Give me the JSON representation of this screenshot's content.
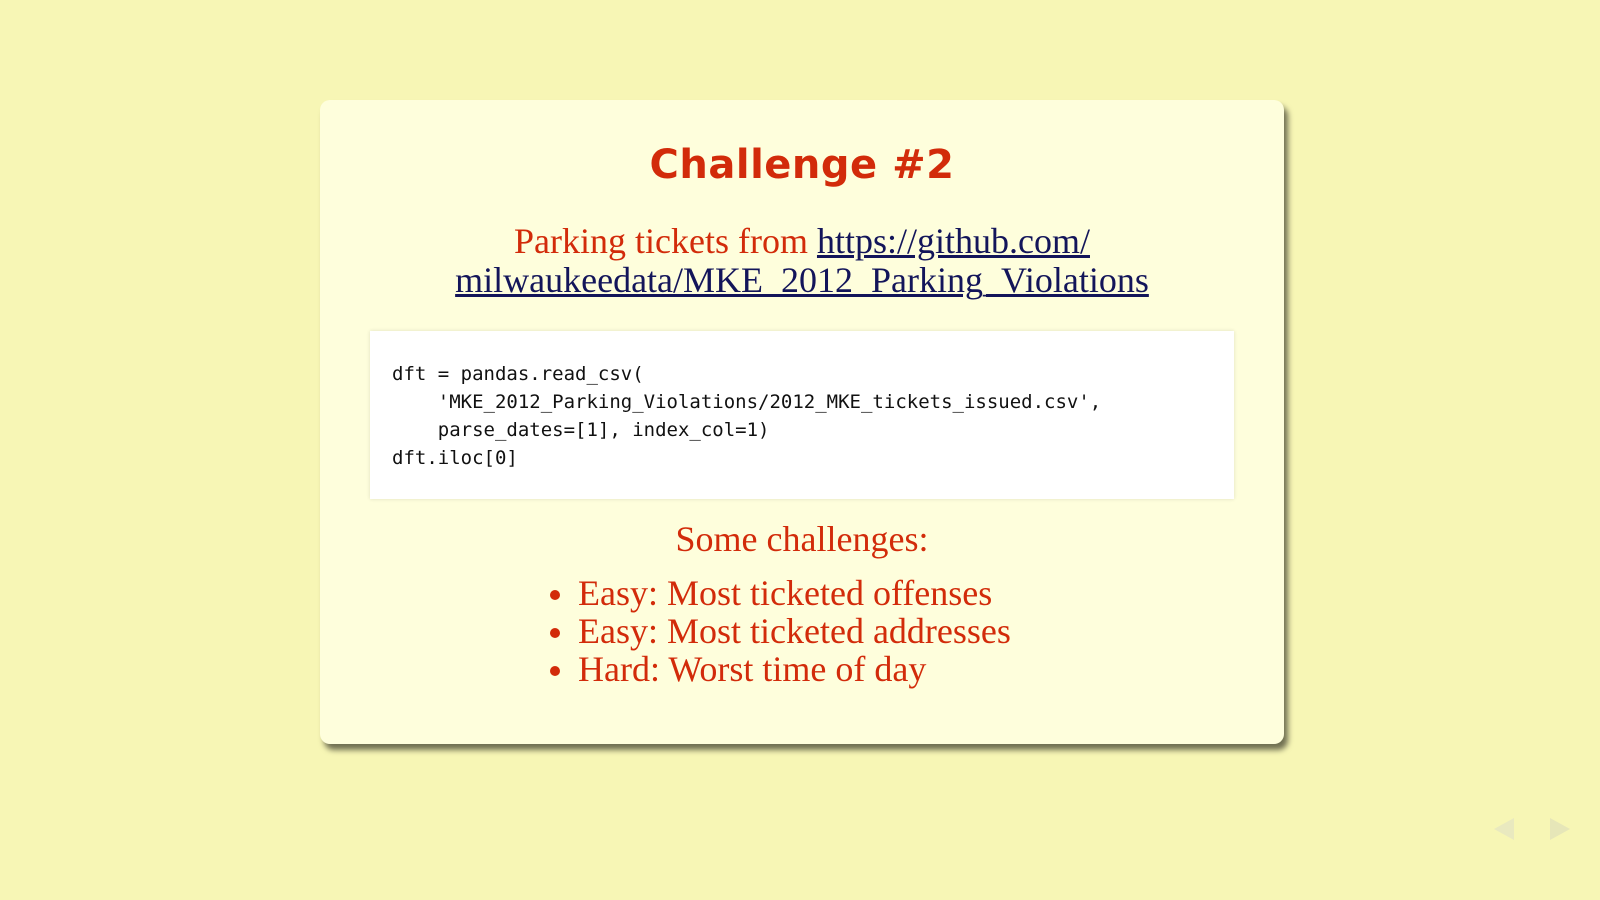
{
  "slide": {
    "title": "Challenge #2",
    "intro_text": "Parking tickets from ",
    "intro_link": "https://github.com/​milwaukeedata/MKE_2012_Parking_Violations",
    "code": "dft = pandas.read_csv(\n    'MKE_2012_Parking_Violations/2012_MKE_tickets_issued.csv',\n    parse_dates=[1], index_col=1)\ndft.iloc[0]",
    "challenges_heading": "Some challenges:",
    "challenges": [
      "Easy: Most ticketed offenses",
      "Easy: Most ticketed addresses",
      "Hard: Worst time of day"
    ]
  },
  "navigation": {
    "prev_icon": "triangle-left-icon",
    "next_icon": "triangle-right-icon"
  },
  "colors": {
    "background": "#f7f6b5",
    "slide": "#fefedc",
    "accent": "#d22b0a",
    "link": "#13155a"
  }
}
